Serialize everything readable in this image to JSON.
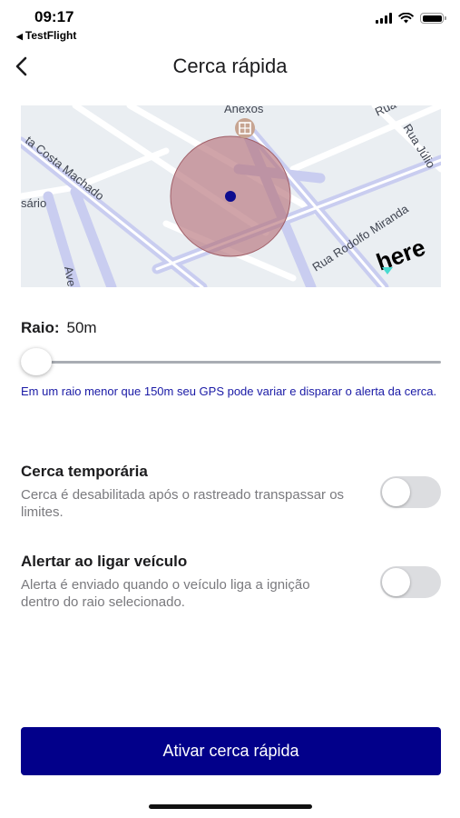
{
  "status_bar": {
    "time": "09:17",
    "back_app": "TestFlight"
  },
  "nav": {
    "title": "Cerca rápida"
  },
  "map": {
    "labels": {
      "annex": "Anexos",
      "costa": "ta Costa Machado",
      "sario": "sário",
      "ave": "Ave",
      "rodolfo": "Rua Rodolfo Miranda",
      "julio": "Rua Júlio",
      "rua_top": "Rua",
      "logo": "here"
    },
    "colors": {
      "fence": "#b7737b",
      "center": "#0d0d8f",
      "road": "#c9cdf0",
      "bg": "#eaeef2"
    }
  },
  "radius": {
    "label": "Raio:",
    "value": "50m",
    "slider_level": 0.0
  },
  "hint": "Em um raio menor que 150m seu GPS pode variar e disparar o alerta da cerca.",
  "settings": [
    {
      "title": "Cerca temporária",
      "description": "Cerca é desabilitada após o rastreado transpassar os limites.",
      "enabled": false
    },
    {
      "title": "Alertar ao ligar veículo",
      "description": "Alerta é enviado quando o veículo liga a ignição dentro do raio selecionado.",
      "enabled": false
    }
  ],
  "primary_button": {
    "label": "Ativar cerca rápida",
    "color": "#02008a"
  }
}
